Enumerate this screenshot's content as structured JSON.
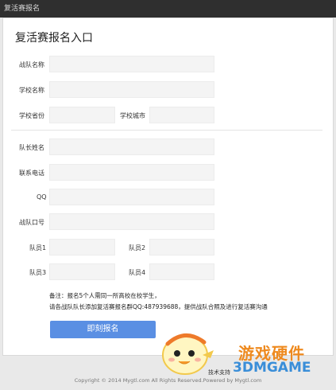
{
  "window": {
    "title": "复活赛报名"
  },
  "form": {
    "heading": "复活赛报名入口",
    "fields": {
      "team_name": "战队名称",
      "school_name": "学校名称",
      "school_province": "学校省份",
      "school_city": "学校城市",
      "captain_name": "队长姓名",
      "phone": "联系电话",
      "qq": "QQ",
      "team_slogan": "战队口号",
      "member1": "队员1",
      "member2": "队员2",
      "member3": "队员3",
      "member4": "队员4"
    },
    "note_line1": "备注：报名5个人需同一所高校在校学生，",
    "note_line2": "请各战队队长添加复活赛报名群QQ:487939688，提供战队合照及进行复活赛沟通",
    "submit_label": "即刻报名"
  },
  "footer": {
    "support": "技术支持",
    "copyright": "Copyright © 2014 Mygtl.com All Rights Reserved.Powered by Mygtl.com"
  },
  "watermark": {
    "line1": "游戏硬件",
    "line2": "3DMGAME"
  }
}
